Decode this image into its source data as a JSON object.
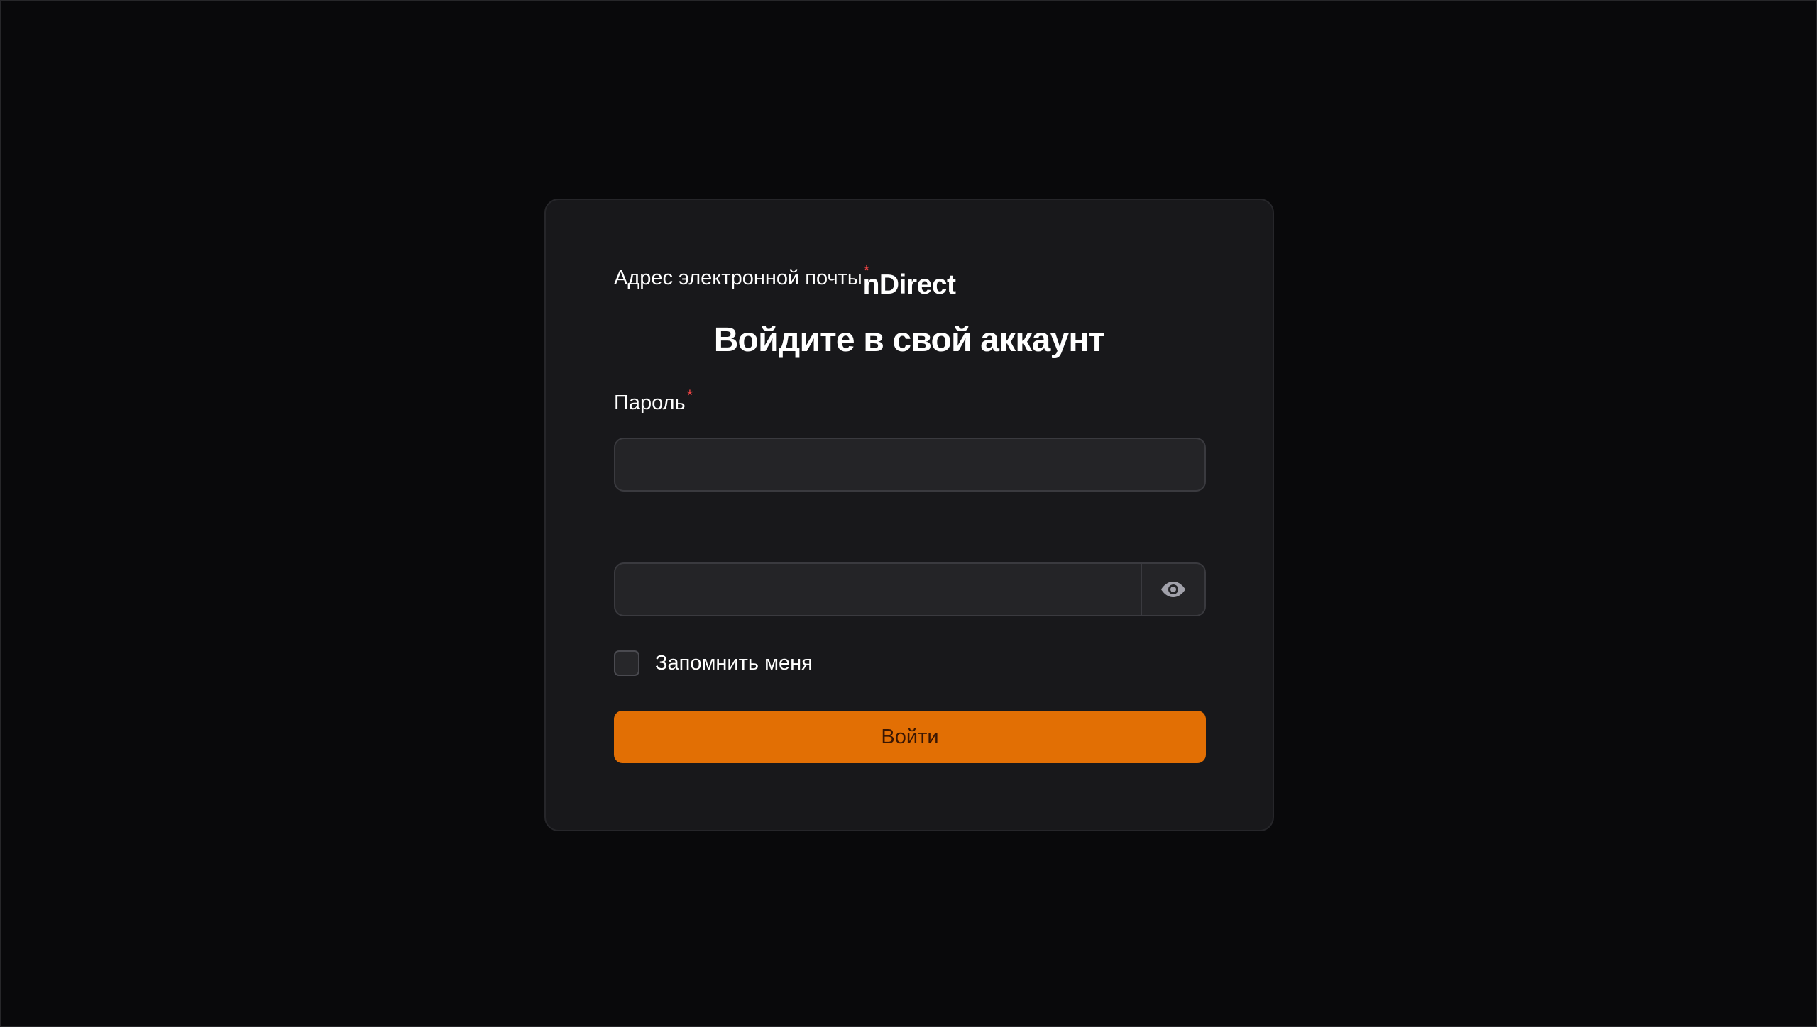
{
  "login": {
    "brand": "nDirect",
    "heading": "Войдите в свой аккаунт",
    "email": {
      "label": "Адрес электронной почты",
      "required_mark": "*",
      "value": "",
      "placeholder": ""
    },
    "password": {
      "label": "Пароль",
      "required_mark": "*",
      "value": "",
      "placeholder": "",
      "toggle_icon": "eye-icon"
    },
    "remember": {
      "label": "Запомнить меня",
      "checked": false
    },
    "submit_label": "Войти"
  },
  "colors": {
    "background": "#09090b",
    "card": "#18181b",
    "input": "#242427",
    "accent": "#e26f04",
    "required": "#ef4444",
    "icon": "#a1a1aa"
  }
}
